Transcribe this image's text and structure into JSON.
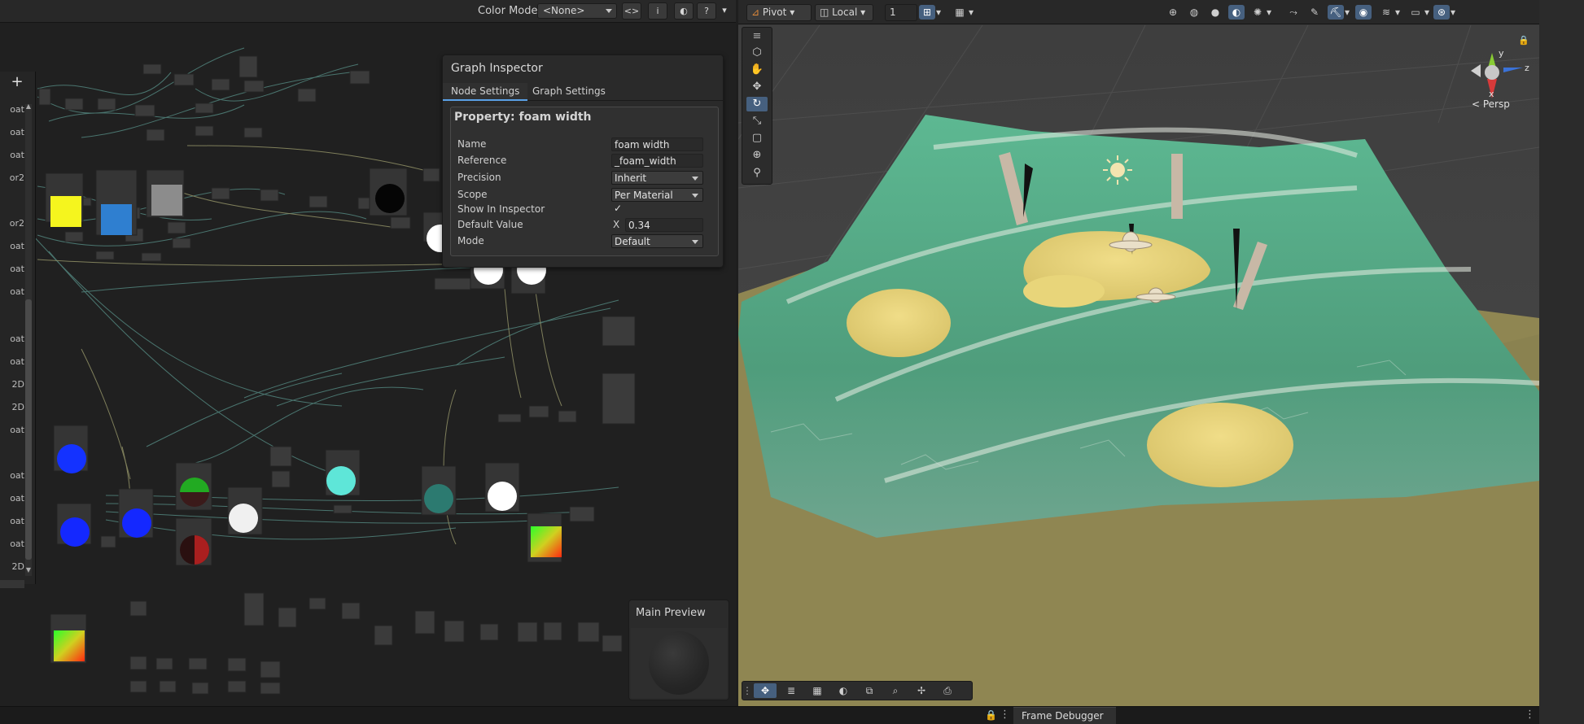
{
  "graph_toolbar": {
    "color_mode_label": "Color Mode",
    "color_mode_value": "<None>",
    "buttons": [
      "<>",
      "i",
      "◐",
      "?",
      "▾"
    ]
  },
  "blackboard": {
    "add_label": "+",
    "rows": [
      "oat",
      "oat",
      "oat",
      "or2",
      "or2",
      "oat",
      "oat",
      "oat",
      "oat",
      "oat",
      "2D",
      "2D",
      "oat",
      "oat",
      "oat",
      "oat",
      "oat",
      "2D"
    ]
  },
  "inspector": {
    "title": "Graph Inspector",
    "tabs": [
      "Node Settings",
      "Graph Settings"
    ],
    "property_title": "Property: foam width",
    "fields": {
      "name_label": "Name",
      "name_value": "foam width",
      "reference_label": "Reference",
      "reference_value": "_foam_width",
      "precision_label": "Precision",
      "precision_value": "Inherit",
      "scope_label": "Scope",
      "scope_value": "Per Material",
      "show_label": "Show In Inspector",
      "show_value": "✓",
      "default_label": "Default Value",
      "default_axis": "X",
      "default_value": "0.34",
      "mode_label": "Mode",
      "mode_value": "Default"
    }
  },
  "main_preview": {
    "title": "Main Preview"
  },
  "scene_toolbar": {
    "pivot": "Pivot",
    "local": "Local",
    "grid_value": "1"
  },
  "scene": {
    "persp_label": "< Persp",
    "axis_y": "y",
    "axis_z": "z",
    "axis_x": "x",
    "colors": {
      "water": "#5aa88a",
      "sand": "#e6d27e",
      "ground": "#8f8652",
      "plane": "#4a4a4a"
    }
  },
  "status_bar": {
    "frame_debugger": "Frame Debugger"
  }
}
